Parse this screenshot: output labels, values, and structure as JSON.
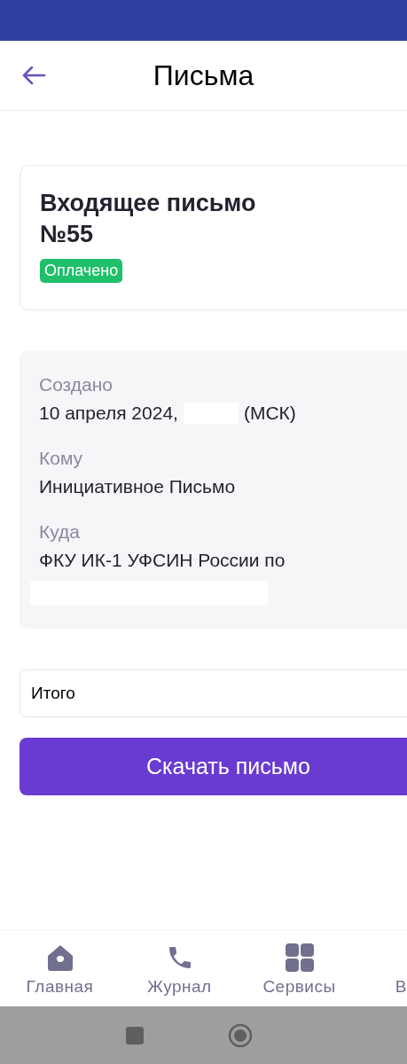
{
  "header": {
    "title": "Письма"
  },
  "letter": {
    "title": "Входящее письмо",
    "number": "№55",
    "status": "Оплачено"
  },
  "details": [
    {
      "label": "Создано",
      "value": "10 апреля 2024,",
      "suffix": "(МСК)",
      "redacted": true
    },
    {
      "label": "Кому",
      "value": "Инициативное Письмо"
    },
    {
      "label": "Куда",
      "value": "ФКУ ИК-1 УФСИН России по",
      "redacted_line": true
    }
  ],
  "total": {
    "label": "Итого"
  },
  "download_button": "Скачать письмо",
  "nav": [
    {
      "kind": "home",
      "label": "Главная"
    },
    {
      "kind": "phone",
      "label": "Журнал"
    },
    {
      "kind": "grid",
      "label": "Сервисы"
    },
    {
      "kind": "partial",
      "label": "В"
    }
  ]
}
